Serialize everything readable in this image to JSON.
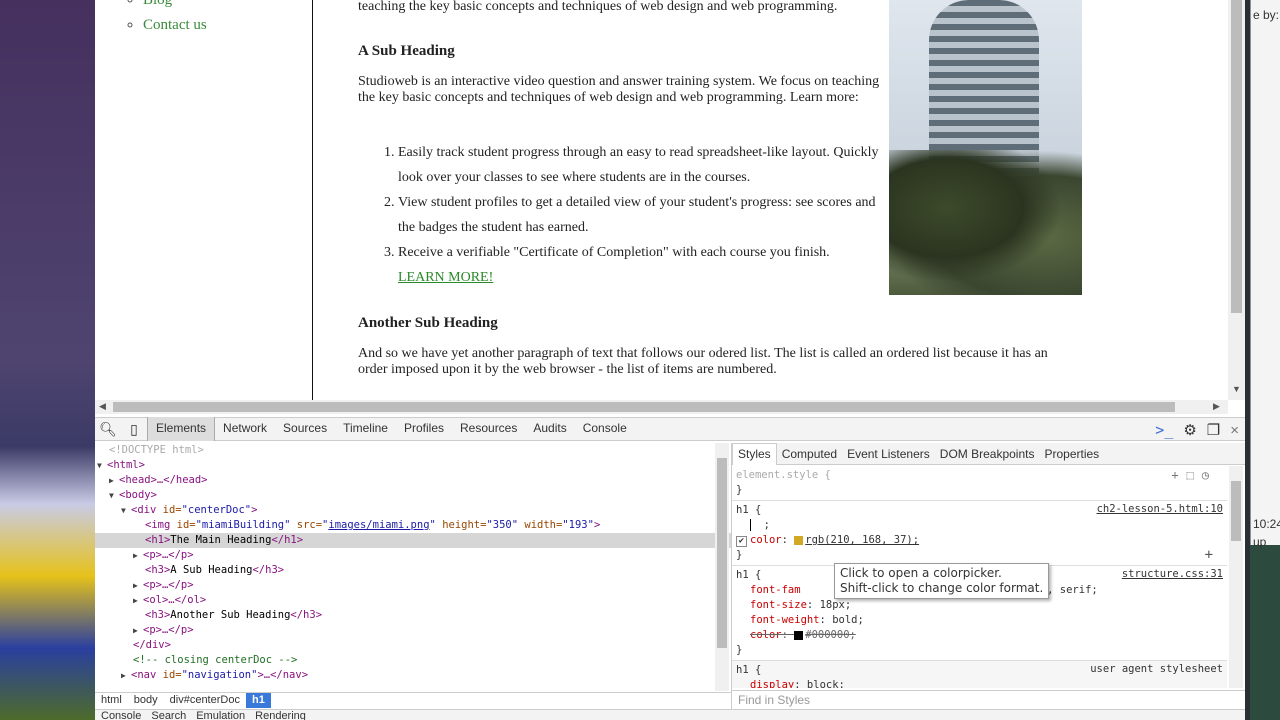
{
  "desktop": {
    "right_texts": [
      "e by:",
      "10:24",
      "up"
    ]
  },
  "page": {
    "nav_links": [
      "Blog",
      "Contact us"
    ],
    "intro_tail": "teaching the key basic concepts and techniques of web design and web programming.",
    "sub_heading": "A Sub Heading",
    "paragraph": "Studioweb is an interactive video question and answer training system. We focus on teaching the key basic concepts and techniques of web design and web programming. Learn more:",
    "list": [
      "Easily track student progress through an easy to read spreadsheet-like layout. Quickly look over your classes to see where students are in the courses.",
      "View student profiles to get a detailed view of your student's progress: see scores and the badges the student has earned.",
      "Receive a verifiable \"Certificate of Completion\" with each course you finish."
    ],
    "learn_more": "LEARN MORE!",
    "another_heading": "Another Sub Heading",
    "paragraph2": "And so we have yet another paragraph of text that follows our odered list. The list is called an ordered list because it has an order imposed upon it by the web browser - the list of items are numbered."
  },
  "devtools": {
    "tabs": [
      "Elements",
      "Network",
      "Sources",
      "Timeline",
      "Profiles",
      "Resources",
      "Audits",
      "Console"
    ],
    "dom": {
      "doctype": "<!DOCTYPE html>",
      "html": "<html>",
      "head": "<head>…</head>",
      "body": "<body>",
      "div_open": "<div",
      "div_attr": "id=",
      "div_val": "\"centerDoc\"",
      "gt": ">",
      "img_open": "<img",
      "img_id_attr": "id=",
      "img_id_val": "\"miamiBuilding\"",
      "img_src_attr": "src=",
      "img_src_val": "images/miami.png",
      "img_h_attr": "height=",
      "img_h_val": "\"350\"",
      "img_w_attr": "width=",
      "img_w_val": "\"193\"",
      "h1_open": "<h1>",
      "h1_text": "The Main Heading",
      "h1_close": "</h1>",
      "p": "<p>…</p>",
      "h3_open": "<h3>",
      "h3_close": "</h3>",
      "h3a": "A Sub Heading",
      "ol": "<ol>…</ol>",
      "h3b": "Another Sub Heading",
      "div_close": "</div>",
      "comment": "<!-- closing centerDoc  -->",
      "nav_open": "<nav",
      "nav_attr": "id=",
      "nav_val": "\"navigation\"",
      "nav_tail": ">…</nav>"
    },
    "breadcrumbs": [
      "html",
      "body",
      "div#centerDoc",
      "h1"
    ],
    "drawer_tabs": [
      "Console",
      "Search",
      "Emulation",
      "Rendering"
    ],
    "styles_tabs": [
      "Styles",
      "Computed",
      "Event Listeners",
      "DOM Breakpoints",
      "Properties"
    ],
    "rules": {
      "element_style": "element.style {",
      "close": "}",
      "h1_sel": "h1 {",
      "r1_src": "ch2-lesson-5.html:10",
      "r1_blank": ";",
      "r1_prop": "color",
      "r1_val": "rgb(210, 168, 37);",
      "r1_color": "#d2a825",
      "r2_src": "structure.css:31",
      "r2_ff_prop": "font-fam",
      "r2_ff_val": "\", Times, serif;",
      "r2_fs_prop": "font-size",
      "r2_fs_val": "18px;",
      "r2_fw_prop": "font-weight",
      "r2_fw_val": "bold;",
      "r2_c_prop": "color",
      "r2_c_val": "#000000;",
      "r3_src": "user agent stylesheet",
      "r3_prop": "display",
      "r3_val": "block;"
    },
    "find_placeholder": "Find in Styles",
    "tooltip": [
      "Click to open a colorpicker.",
      "Shift-click to change color format."
    ]
  }
}
